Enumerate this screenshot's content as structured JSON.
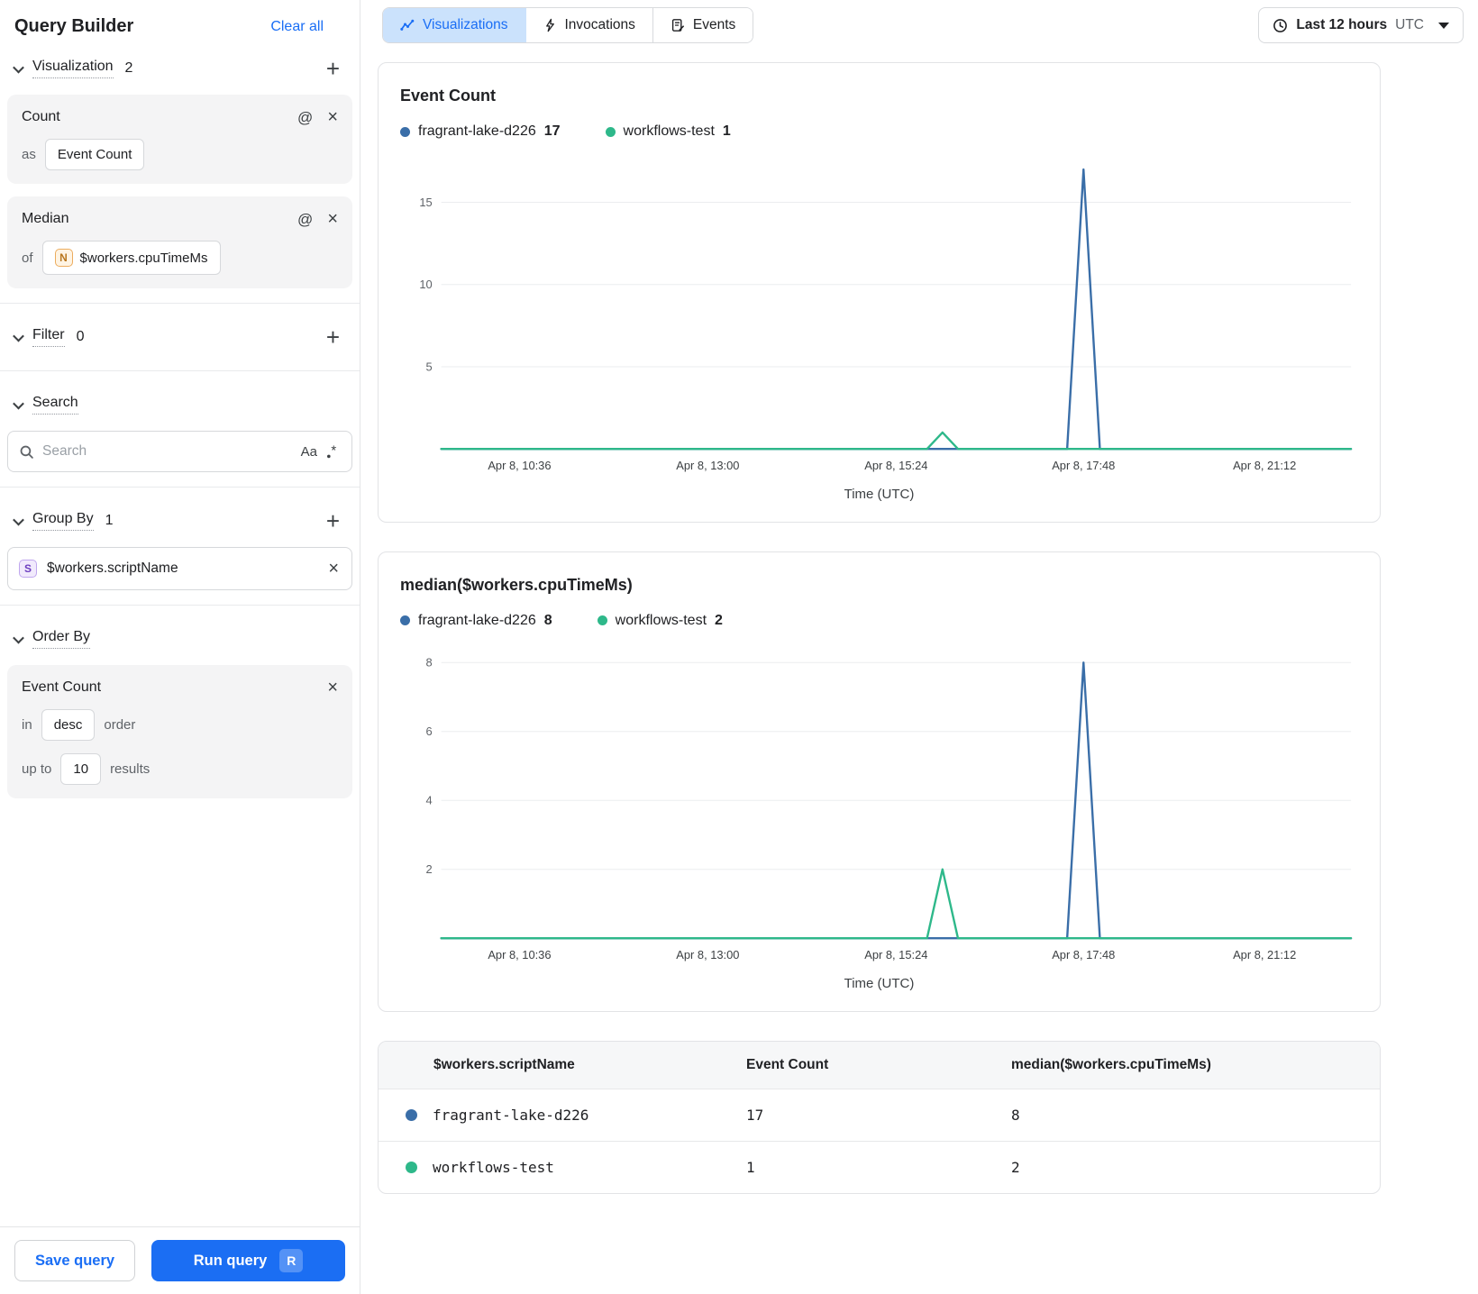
{
  "sidebar": {
    "title": "Query Builder",
    "clear_all": "Clear all",
    "visualization": {
      "label": "Visualization",
      "count": "2",
      "cards": [
        {
          "title": "Count",
          "prefix": "as",
          "value": "Event Count"
        },
        {
          "title": "Median",
          "prefix": "of",
          "type_letter": "N",
          "value": "$workers.cpuTimeMs"
        }
      ]
    },
    "filter": {
      "label": "Filter",
      "count": "0"
    },
    "search": {
      "label": "Search",
      "placeholder": "Search",
      "case_toggle": "Aa"
    },
    "group_by": {
      "label": "Group By",
      "count": "1",
      "item": {
        "type_letter": "S",
        "value": "$workers.scriptName"
      }
    },
    "order_by": {
      "label": "Order By",
      "card": {
        "title": "Event Count",
        "in_label": "in",
        "direction": "desc",
        "order_label": "order",
        "upto_label": "up to",
        "limit": "10",
        "results_label": "results"
      }
    },
    "footer": {
      "save": "Save query",
      "run": "Run query",
      "run_shortcut": "R"
    }
  },
  "topbar": {
    "tabs": [
      {
        "label": "Visualizations"
      },
      {
        "label": "Invocations"
      },
      {
        "label": "Events"
      }
    ],
    "time_range": {
      "label": "Last 12 hours",
      "timezone": "UTC"
    }
  },
  "chart_data": [
    {
      "type": "line",
      "title": "Event Count",
      "xlabel": "Time (UTC)",
      "ylim": [
        0,
        17.5
      ],
      "y_ticks": [
        5,
        10,
        15
      ],
      "grid": "horizontal",
      "legend_position": "top",
      "x_ticks": [
        {
          "label": "Apr 8, 10:36",
          "frac": 0.086
        },
        {
          "label": "Apr 8, 13:00",
          "frac": 0.293
        },
        {
          "label": "Apr 8, 15:24",
          "frac": 0.5
        },
        {
          "label": "Apr 8, 17:48",
          "frac": 0.706
        },
        {
          "label": "Apr 8, 21:12",
          "frac": 0.905
        }
      ],
      "legend": [
        {
          "name": "fragrant-lake-d226",
          "value": "17",
          "color": "#3a6ea8"
        },
        {
          "name": "workflows-test",
          "value": "1",
          "color": "#2eb88a"
        }
      ],
      "series": [
        {
          "name": "fragrant-lake-d226",
          "color": "#3a6ea8",
          "points": [
            [
              0,
              0
            ],
            [
              0.688,
              0
            ],
            [
              0.706,
              17
            ],
            [
              0.724,
              0
            ],
            [
              1,
              0
            ]
          ]
        },
        {
          "name": "workflows-test",
          "color": "#2eb88a",
          "points": [
            [
              0,
              0
            ],
            [
              0.534,
              0
            ],
            [
              0.551,
              1
            ],
            [
              0.568,
              0
            ],
            [
              1,
              0
            ]
          ]
        }
      ]
    },
    {
      "type": "line",
      "title": "median($workers.cpuTimeMs)",
      "xlabel": "Time (UTC)",
      "ylim": [
        0,
        8.35
      ],
      "y_ticks": [
        2,
        4,
        6,
        8
      ],
      "grid": "horizontal",
      "legend_position": "top",
      "x_ticks": [
        {
          "label": "Apr 8, 10:36",
          "frac": 0.086
        },
        {
          "label": "Apr 8, 13:00",
          "frac": 0.293
        },
        {
          "label": "Apr 8, 15:24",
          "frac": 0.5
        },
        {
          "label": "Apr 8, 17:48",
          "frac": 0.706
        },
        {
          "label": "Apr 8, 21:12",
          "frac": 0.905
        }
      ],
      "legend": [
        {
          "name": "fragrant-lake-d226",
          "value": "8",
          "color": "#3a6ea8"
        },
        {
          "name": "workflows-test",
          "value": "2",
          "color": "#2eb88a"
        }
      ],
      "series": [
        {
          "name": "fragrant-lake-d226",
          "color": "#3a6ea8",
          "points": [
            [
              0,
              0
            ],
            [
              0.688,
              0
            ],
            [
              0.706,
              8
            ],
            [
              0.724,
              0
            ],
            [
              1,
              0
            ]
          ]
        },
        {
          "name": "workflows-test",
          "color": "#2eb88a",
          "points": [
            [
              0,
              0
            ],
            [
              0.534,
              0
            ],
            [
              0.551,
              2
            ],
            [
              0.568,
              0
            ],
            [
              1,
              0
            ]
          ]
        }
      ]
    }
  ],
  "table": {
    "columns": [
      "$workers.scriptName",
      "Event Count",
      "median($workers.cpuTimeMs)"
    ],
    "rows": [
      {
        "name": "fragrant-lake-d226",
        "event_count": "17",
        "median": "8",
        "color": "#3a6ea8"
      },
      {
        "name": "workflows-test",
        "event_count": "1",
        "median": "2",
        "color": "#2eb88a"
      }
    ]
  },
  "colors": {
    "accent": "#1a6ef5",
    "series_blue": "#3a6ea8",
    "series_green": "#2eb88a"
  }
}
